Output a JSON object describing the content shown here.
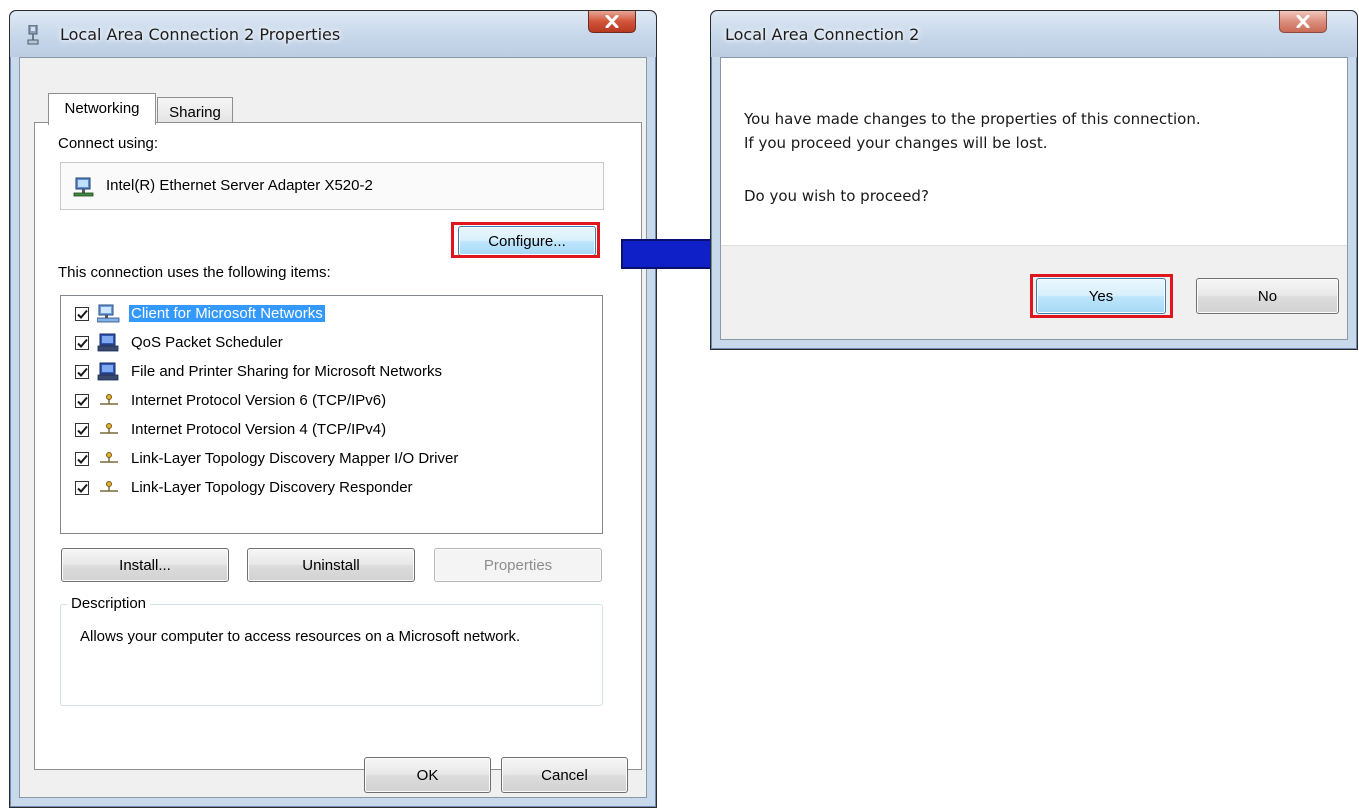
{
  "properties_dialog": {
    "title": "Local Area Connection 2 Properties",
    "tabs": [
      {
        "label": "Networking",
        "active": true
      },
      {
        "label": "Sharing",
        "active": false
      }
    ],
    "connect_using_label": "Connect using:",
    "adapter_name": "Intel(R) Ethernet Server Adapter X520-2",
    "configure_button": "Configure...",
    "items_label": "This connection uses the following items:",
    "items": [
      {
        "label": "Client for Microsoft Networks",
        "checked": true,
        "selected": true,
        "icon": "network-client-icon"
      },
      {
        "label": "QoS Packet Scheduler",
        "checked": true,
        "selected": false,
        "icon": "computer-service-icon"
      },
      {
        "label": "File and Printer Sharing for Microsoft Networks",
        "checked": true,
        "selected": false,
        "icon": "computer-service-icon"
      },
      {
        "label": "Internet Protocol Version 6 (TCP/IPv6)",
        "checked": true,
        "selected": false,
        "icon": "protocol-icon"
      },
      {
        "label": "Internet Protocol Version 4 (TCP/IPv4)",
        "checked": true,
        "selected": false,
        "icon": "protocol-icon"
      },
      {
        "label": "Link-Layer Topology Discovery Mapper I/O Driver",
        "checked": true,
        "selected": false,
        "icon": "protocol-icon"
      },
      {
        "label": "Link-Layer Topology Discovery Responder",
        "checked": true,
        "selected": false,
        "icon": "protocol-icon"
      }
    ],
    "install_button": "Install...",
    "uninstall_button": "Uninstall",
    "properties_button": "Properties",
    "description_title": "Description",
    "description_text": "Allows your computer to access resources on a Microsoft network.",
    "ok_button": "OK",
    "cancel_button": "Cancel"
  },
  "confirm_dialog": {
    "title": "Local Area Connection 2",
    "message_line1": "You have made changes to the properties of this connection.",
    "message_line2": "If you proceed your changes will be lost.",
    "question": "Do you wish to proceed?",
    "yes_button": "Yes",
    "no_button": "No"
  },
  "colors": {
    "highlight": "#e0161e",
    "arrow": "#1020c8",
    "selection": "#3399ff",
    "close_button": "#c9442a"
  }
}
